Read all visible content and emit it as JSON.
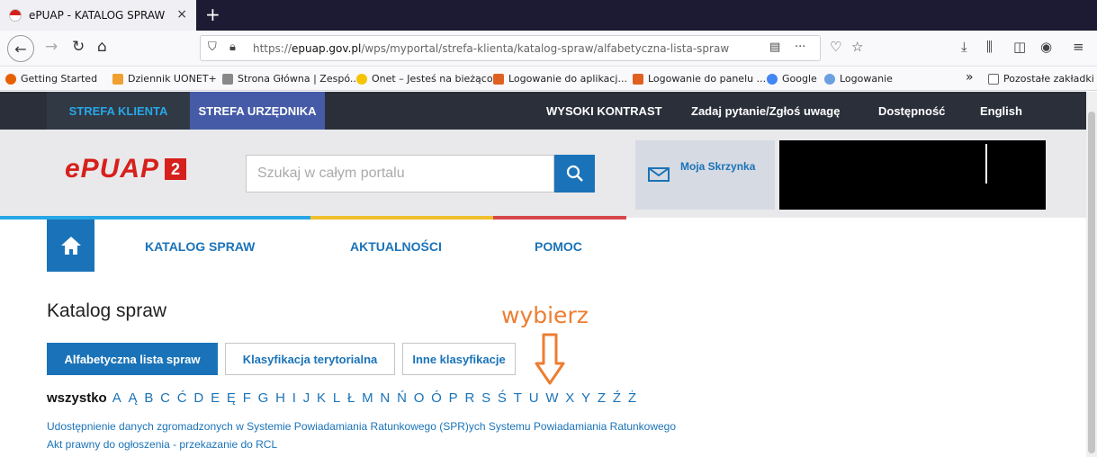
{
  "browser": {
    "tab_title": "ePUAP - KATALOG SPRAW",
    "tab_close": "×",
    "new_tab": "+",
    "url_prefix": "https://",
    "url_domain": "epuap.gov.pl",
    "url_path": "/wps/myportal/strefa-klienta/katalog-spraw/alfabetyczna-lista-spraw",
    "bookmarks": [
      {
        "label": "Getting Started",
        "color": "#e66000"
      },
      {
        "label": "Dziennik UONET+",
        "color": "#f0a030"
      },
      {
        "label": "Strona Główna | Zespó...",
        "color": "#888888"
      },
      {
        "label": "Onet – Jesteś na bieżąco",
        "color": "#f5c400"
      },
      {
        "label": "Logowanie do aplikacj...",
        "color": "#e06020"
      },
      {
        "label": "Logowanie do panelu ...",
        "color": "#e06020"
      },
      {
        "label": "Google",
        "color": "#4285f4"
      },
      {
        "label": "Logowanie",
        "color": "#6aa0e0"
      }
    ],
    "bookmarks_overflow": "»",
    "other_bookmarks": "Pozostałe zakładki"
  },
  "topbar": {
    "strefa_klienta": "STREFA KLIENTA",
    "strefa_urzednika": "STREFA URZĘDNIKA",
    "wysoki_kontrast": "WYSOKI KONTRAST",
    "zadaj_pytanie": "Zadaj pytanie/Zgłoś uwagę",
    "dostepnosc": "Dostępność",
    "english": "English"
  },
  "header": {
    "logo_text": "ePUAP",
    "logo_version": "2",
    "search_placeholder": "Szukaj w całym portalu",
    "mailbox_label": "Moja Skrzynka"
  },
  "mainnav": {
    "items": [
      "KATALOG SPRAW",
      "AKTUALNOŚCI",
      "POMOC"
    ]
  },
  "content": {
    "title": "Katalog spraw",
    "hint": "wybierz",
    "filter_buttons": [
      "Alfabetyczna lista spraw",
      "Klasyfikacja terytorialna",
      "Inne klasyfikacje"
    ],
    "all_label": "wszystko",
    "letters": [
      "A",
      "Ą",
      "B",
      "C",
      "Ć",
      "D",
      "E",
      "Ę",
      "F",
      "G",
      "H",
      "I",
      "J",
      "K",
      "L",
      "Ł",
      "M",
      "N",
      "Ń",
      "O",
      "Ó",
      "P",
      "R",
      "S",
      "Ś",
      "T",
      "U",
      "W",
      "X",
      "Y",
      "Z",
      "Ź",
      "Ż"
    ],
    "results": [
      "Udostępnienie danych zgromadzonych w Systemie Powiadamiania Ratunkowego (SPR)ych Systemu Powiadamiania Ratunkowego",
      "Akt prawny do ogłoszenia - przekazanie do RCL"
    ]
  },
  "colors": {
    "brand_red": "#d6201c",
    "brand_blue": "#1a73b8",
    "hint_orange": "#ed7d31"
  }
}
